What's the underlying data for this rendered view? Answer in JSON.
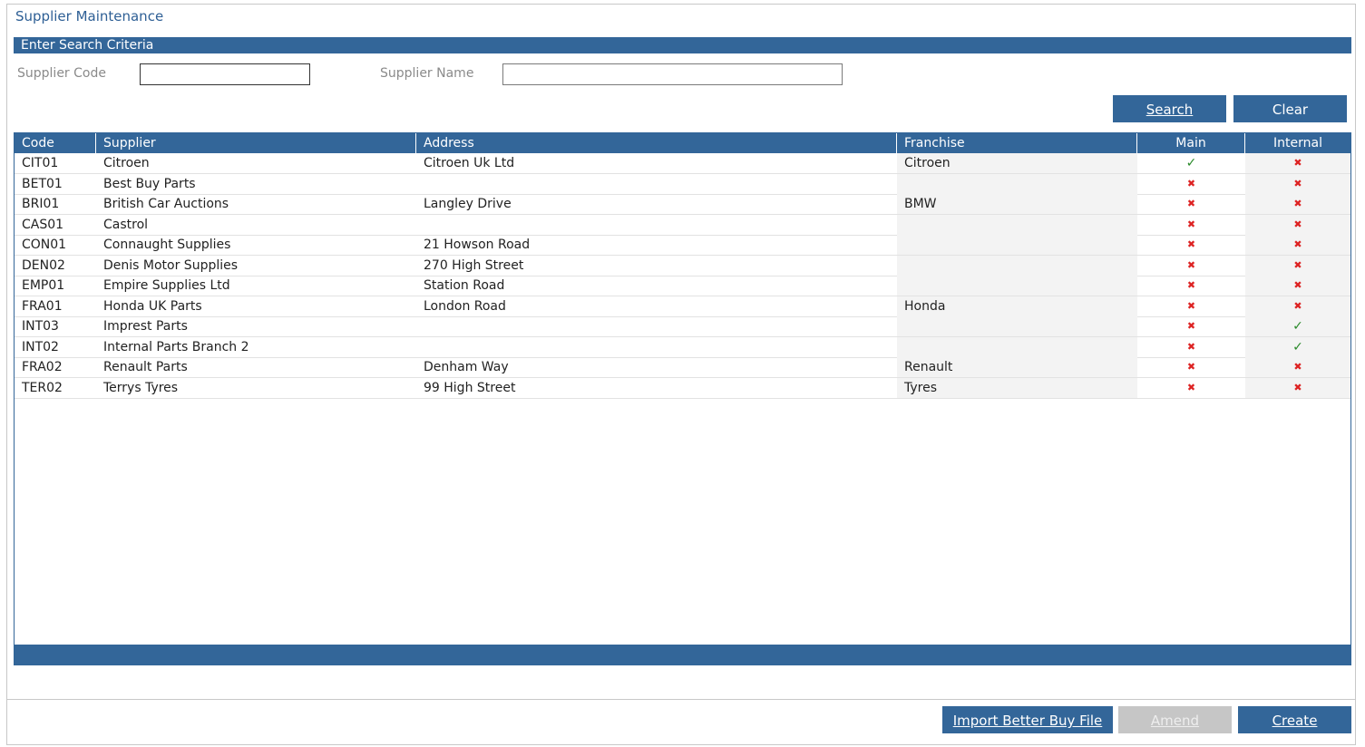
{
  "title": "Supplier Maintenance",
  "search_section": {
    "header": "Enter Search Criteria",
    "supplier_code_label": "Supplier Code",
    "supplier_code_value": "",
    "supplier_name_label": "Supplier Name",
    "supplier_name_value": "",
    "search_button": "Search",
    "clear_button": "Clear"
  },
  "grid": {
    "columns": [
      "Code",
      "Supplier",
      "Address",
      "Franchise",
      "Main",
      "Internal"
    ],
    "rows": [
      {
        "code": "CIT01",
        "supplier": "Citroen",
        "address": "Citroen Uk Ltd",
        "franchise": "Citroen",
        "main": true,
        "internal": false
      },
      {
        "code": "BET01",
        "supplier": "Best Buy Parts",
        "address": "",
        "franchise": "",
        "main": false,
        "internal": false
      },
      {
        "code": "BRI01",
        "supplier": "British Car Auctions",
        "address": "Langley Drive",
        "franchise": "BMW",
        "main": false,
        "internal": false
      },
      {
        "code": "CAS01",
        "supplier": "Castrol",
        "address": "",
        "franchise": "",
        "main": false,
        "internal": false
      },
      {
        "code": "CON01",
        "supplier": "Connaught Supplies",
        "address": "21 Howson Road",
        "franchise": "",
        "main": false,
        "internal": false
      },
      {
        "code": "DEN02",
        "supplier": "Denis Motor Supplies",
        "address": "270 High Street",
        "franchise": "",
        "main": false,
        "internal": false
      },
      {
        "code": "EMP01",
        "supplier": "Empire Supplies Ltd",
        "address": "Station Road",
        "franchise": "",
        "main": false,
        "internal": false
      },
      {
        "code": "FRA01",
        "supplier": "Honda UK Parts",
        "address": "London Road",
        "franchise": "Honda",
        "main": false,
        "internal": false
      },
      {
        "code": "INT03",
        "supplier": "Imprest Parts",
        "address": "",
        "franchise": "",
        "main": false,
        "internal": true
      },
      {
        "code": "INT02",
        "supplier": "Internal Parts Branch 2",
        "address": "",
        "franchise": "",
        "main": false,
        "internal": true
      },
      {
        "code": "FRA02",
        "supplier": "Renault Parts",
        "address": "Denham Way",
        "franchise": "Renault",
        "main": false,
        "internal": false
      },
      {
        "code": "TER02",
        "supplier": "Terrys Tyres",
        "address": "99 High Street",
        "franchise": "Tyres",
        "main": false,
        "internal": false
      }
    ]
  },
  "footer": {
    "import_button": "Import Better Buy File",
    "amend_button": "Amend",
    "create_button": "Create"
  },
  "icons": {
    "true": "check-icon",
    "false": "cross-icon"
  },
  "colors": {
    "accent": "#336699",
    "check": "#2a8a2a",
    "cross": "#dd2222",
    "disabled": "#c6c6c6"
  }
}
